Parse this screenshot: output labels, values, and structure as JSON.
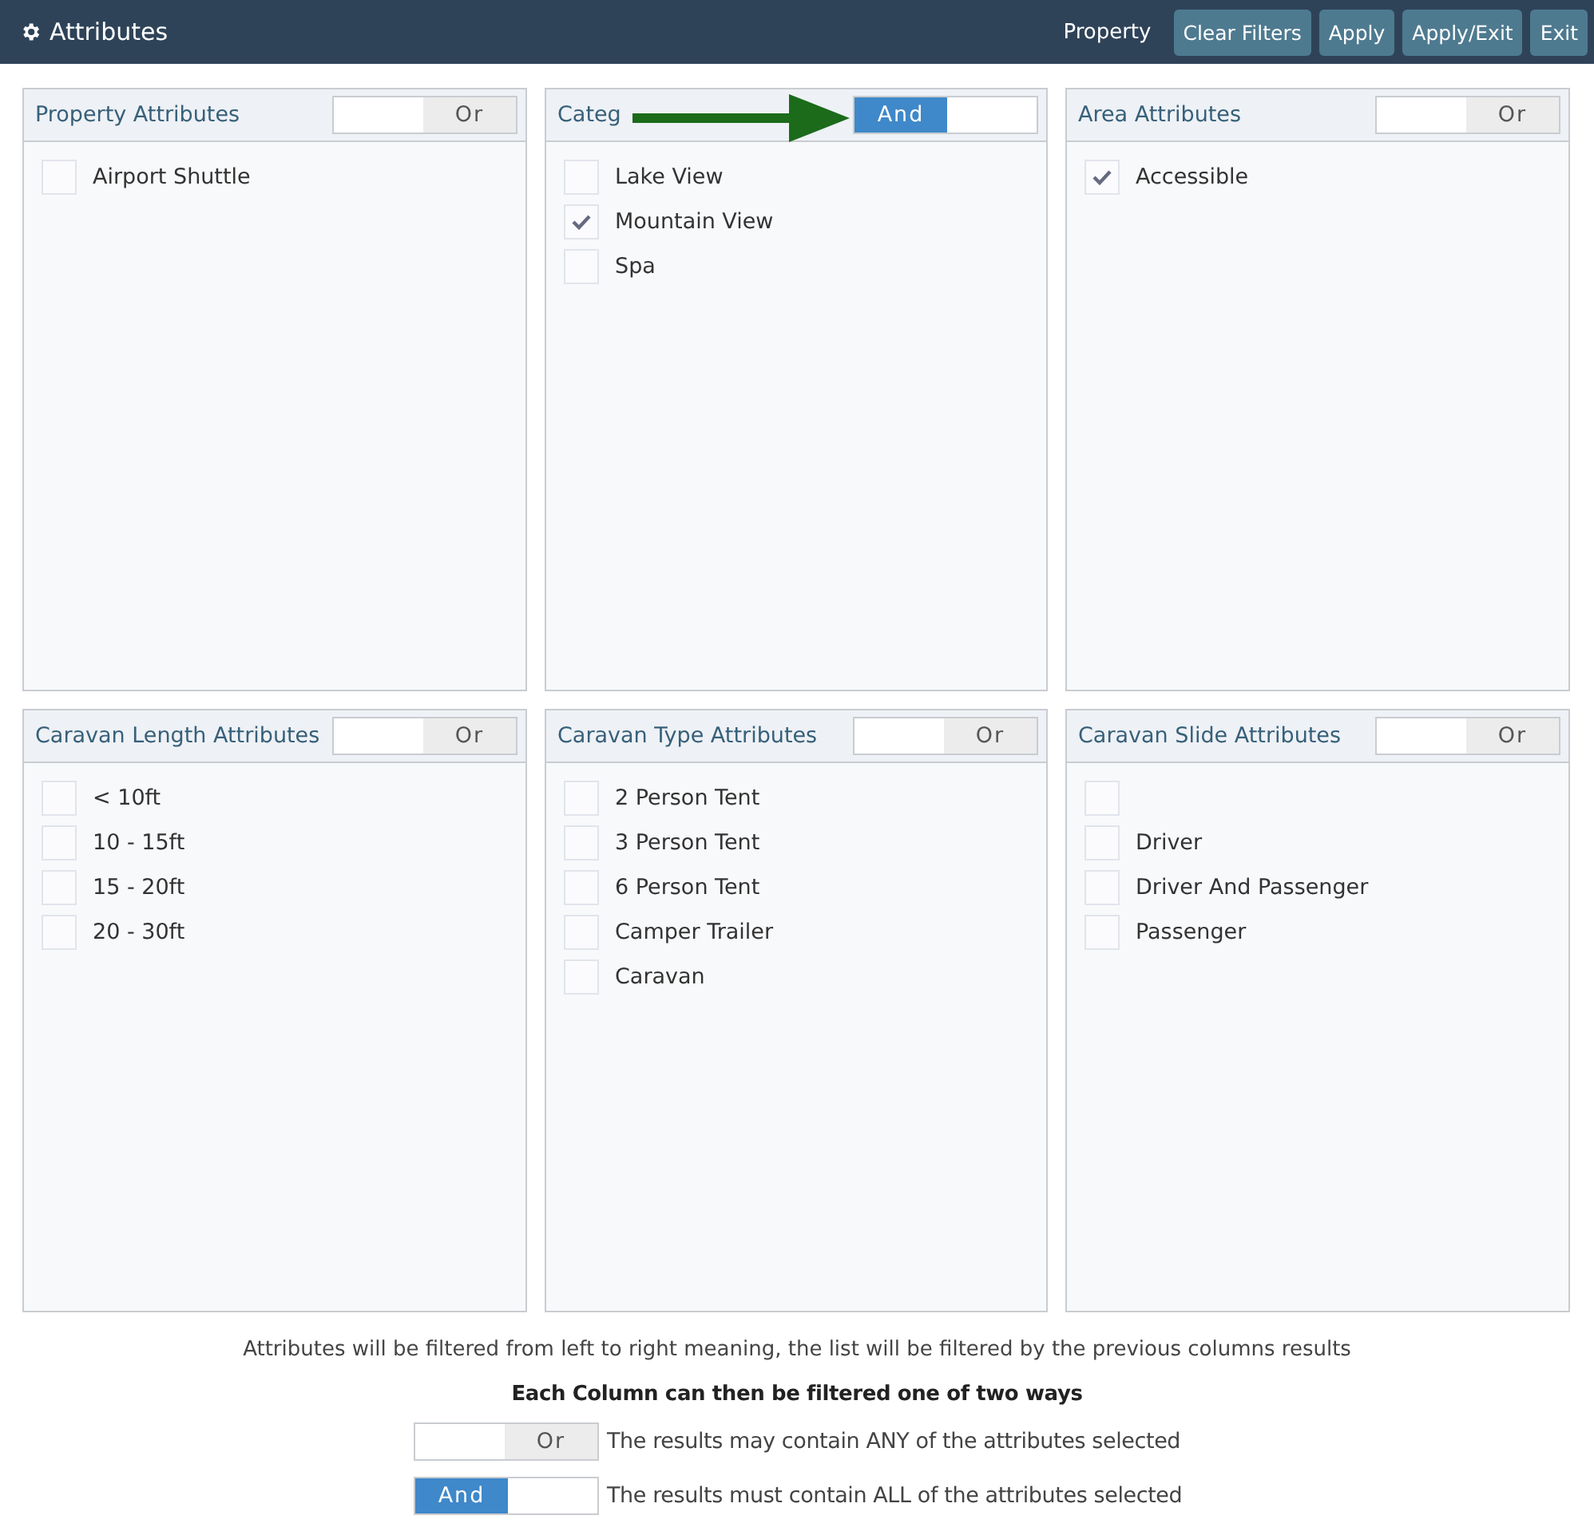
{
  "header": {
    "title": "Attributes",
    "context": "Property",
    "buttons": [
      "Clear Filters",
      "Apply",
      "Apply/Exit",
      "Exit"
    ]
  },
  "panels": [
    {
      "title": "Property Attributes",
      "toggle": {
        "label": "Or",
        "on": false
      },
      "arrow": false,
      "items": [
        {
          "label": "Airport Shuttle",
          "checked": false
        }
      ]
    },
    {
      "title": "Categ",
      "toggle": {
        "label": "And",
        "on": true
      },
      "arrow": true,
      "items": [
        {
          "label": "Lake View",
          "checked": false
        },
        {
          "label": "Mountain View",
          "checked": true
        },
        {
          "label": "Spa",
          "checked": false
        }
      ]
    },
    {
      "title": "Area Attributes",
      "toggle": {
        "label": "Or",
        "on": false
      },
      "arrow": false,
      "items": [
        {
          "label": "Accessible",
          "checked": true
        }
      ]
    },
    {
      "title": "Caravan Length Attributes",
      "toggle": {
        "label": "Or",
        "on": false
      },
      "arrow": false,
      "items": [
        {
          "label": "< 10ft",
          "checked": false
        },
        {
          "label": "10 - 15ft",
          "checked": false
        },
        {
          "label": "15 - 20ft",
          "checked": false
        },
        {
          "label": "20 - 30ft",
          "checked": false
        }
      ]
    },
    {
      "title": "Caravan Type Attributes",
      "toggle": {
        "label": "Or",
        "on": false
      },
      "arrow": false,
      "items": [
        {
          "label": "2 Person Tent",
          "checked": false
        },
        {
          "label": "3 Person Tent",
          "checked": false
        },
        {
          "label": "6 Person Tent",
          "checked": false
        },
        {
          "label": "Camper Trailer",
          "checked": false
        },
        {
          "label": "Caravan",
          "checked": false
        }
      ]
    },
    {
      "title": "Caravan Slide Attributes",
      "toggle": {
        "label": "Or",
        "on": false
      },
      "arrow": false,
      "items": [
        {
          "checked": false
        },
        {
          "label": "Driver",
          "checked": false
        },
        {
          "label": "Driver And Passenger",
          "checked": false
        },
        {
          "label": "Passenger",
          "checked": false
        }
      ]
    }
  ],
  "help": {
    "note": "Attributes will be filtered from left to right meaning, the list will be filtered by the previous columns results",
    "heading": "Each Column can then be filtered one of two ways",
    "legend": [
      {
        "toggle": {
          "label": "Or",
          "on": false
        },
        "text": "The results may contain ANY of the attributes selected"
      },
      {
        "toggle": {
          "label": "And",
          "on": true
        },
        "text": "The results must contain ALL of the attributes selected"
      }
    ]
  }
}
